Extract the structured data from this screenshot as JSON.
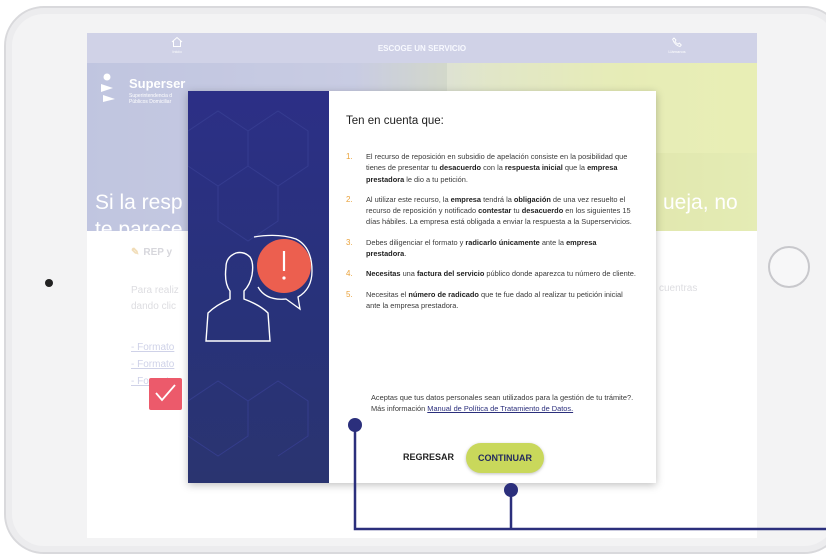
{
  "topbar": {
    "home_label": "Inicio",
    "title": "ESCOGE UN SERVICIO",
    "call_label": "Llámanos"
  },
  "logo": {
    "name": "Superser",
    "sub1": "Superintendencia d",
    "sub2": "Públicos Domiciliar"
  },
  "hero": {
    "line1_left": "Si la resp",
    "line1_right": "ueja, no",
    "line2_left": "te parece"
  },
  "content": {
    "rep_label": "REP y",
    "para_line1": "Para realiz",
    "para_line2": "dando clic",
    "para_right": "cuentras",
    "links": [
      "- Formato",
      "- Formato",
      "- Formato"
    ]
  },
  "modal": {
    "title": "Ten en cuenta que:",
    "items": [
      {
        "num": "1.",
        "parts": [
          [
            "",
            "El recurso de reposición en subsidio de apelación consiste en la posibilidad que tienes de presentar tu "
          ],
          [
            "b",
            "desacuerdo"
          ],
          [
            "",
            " con la "
          ],
          [
            "b",
            "respuesta inicial"
          ],
          [
            "",
            " que la "
          ],
          [
            "b",
            "empresa prestadora"
          ],
          [
            "",
            " le dio a tu petición."
          ]
        ]
      },
      {
        "num": "2.",
        "parts": [
          [
            "",
            "Al utilizar este recurso, la "
          ],
          [
            "b",
            "empresa"
          ],
          [
            "",
            " tendrá la "
          ],
          [
            "b",
            "obligación"
          ],
          [
            "",
            " de una vez resuelto el recurso de reposición y notificado "
          ],
          [
            "b",
            "contestar"
          ],
          [
            "",
            " tu "
          ],
          [
            "b",
            "desacuerdo"
          ],
          [
            "",
            " en los siguientes 15 días hábiles. La empresa está obligada a enviar la respuesta a la Superservicios."
          ]
        ]
      },
      {
        "num": "3.",
        "parts": [
          [
            "",
            "Debes diligenciar el formato y "
          ],
          [
            "b",
            "radicarlo únicamente"
          ],
          [
            "",
            " ante la "
          ],
          [
            "b",
            "empresa prestadora"
          ],
          [
            "",
            "."
          ]
        ]
      },
      {
        "num": "4.",
        "parts": [
          [
            "b",
            "Necesitas"
          ],
          [
            "",
            " una "
          ],
          [
            "b",
            "factura del servicio"
          ],
          [
            "",
            " público donde aparezca tu número de cliente."
          ]
        ]
      },
      {
        "num": "5.",
        "parts": [
          [
            "",
            "Necesitas el "
          ],
          [
            "b",
            "número de radicado"
          ],
          [
            "",
            " que te fue dado al realizar tu petición inicial ante la empresa prestadora."
          ]
        ]
      }
    ],
    "consent_text": "Aceptas que tus datos personales sean utilizados para la gestión de tu trámite?. Más información ",
    "consent_link": "Manual de Política de Tratamiento de Datos.",
    "back_label": "REGRESAR",
    "continue_label": "CONTINUAR"
  },
  "colors": {
    "modal_left": "#2c2f86",
    "accent_number": "#e9a23b",
    "checkbox": "#ec5a6b",
    "continue_button": "#c9d85b",
    "guide_line": "#2b2f7c"
  }
}
